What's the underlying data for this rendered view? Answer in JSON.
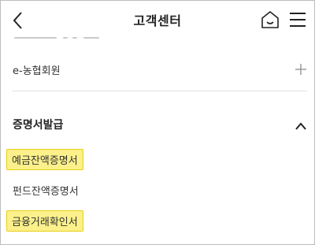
{
  "header": {
    "title": "고객센터",
    "back_icon": "chevron-left-icon",
    "home_icon": "home-icon",
    "menu_icon": "hamburger-menu-icon"
  },
  "list": {
    "member_label": "e-농협회원",
    "member_toggle_icon": "plus-icon",
    "section_title": "증명서발급",
    "section_toggle_icon": "chevron-up-icon",
    "items": [
      {
        "label": "예금잔액증명서",
        "highlighted": true
      },
      {
        "label": "펀드잔액증명서",
        "highlighted": false
      },
      {
        "label": "금융거래확인서",
        "highlighted": true
      }
    ]
  },
  "colors": {
    "highlight_fill": "#fbf08a",
    "highlight_border": "#e9cf19",
    "text": "#222222",
    "divider": "#e3e3e3"
  }
}
